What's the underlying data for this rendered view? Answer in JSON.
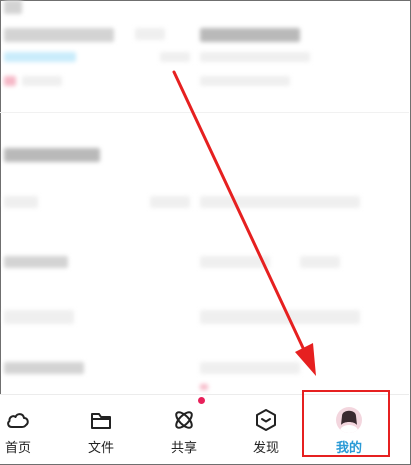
{
  "tabs": [
    {
      "label": "首页",
      "icon": "home-cloud-icon"
    },
    {
      "label": "文件",
      "icon": "folder-icon"
    },
    {
      "label": "共享",
      "icon": "atom-share-icon"
    },
    {
      "label": "发现",
      "icon": "discover-box-icon"
    },
    {
      "label": "我的",
      "icon": "avatar",
      "active": true
    }
  ],
  "colors": {
    "active": "#2a9ad6",
    "badge": "#e8205a",
    "annotation": "#e62020"
  }
}
